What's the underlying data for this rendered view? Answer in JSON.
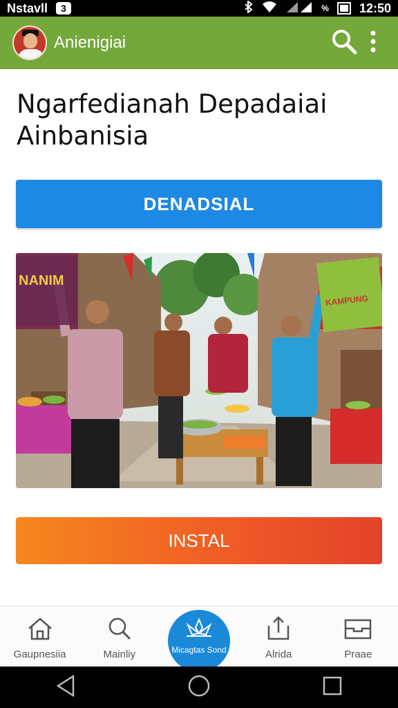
{
  "status_bar": {
    "carrier": "Nstavll",
    "badge": "3",
    "battery_percent_label": "%",
    "time": "12:50"
  },
  "app_bar": {
    "title": "Anienigiai",
    "icons": [
      "avatar",
      "search-icon",
      "more-vert-icon"
    ]
  },
  "headline": {
    "line1": "Ngarfedianah Depadaiai",
    "line2": "Ainbanisia"
  },
  "primary_button": {
    "label": "DENADSIAL",
    "color": "#1e88e5"
  },
  "photo": {
    "banner_left": "NANIM",
    "banner_right": "KAMPUNG"
  },
  "install_button": {
    "label": "INSTAL",
    "color_start": "#f6871e",
    "color_end": "#e2432a"
  },
  "bottom_nav": {
    "items": [
      {
        "label": "Gaupnesiia",
        "icon": "home-icon"
      },
      {
        "label": "Mainliy",
        "icon": "search-icon"
      },
      {
        "label": "Micagtas Sond",
        "icon": "lotus-icon"
      },
      {
        "label": "Alrida",
        "icon": "share-icon"
      },
      {
        "label": "Praae",
        "icon": "inbox-icon"
      }
    ],
    "center_color": "#1a89d8"
  },
  "colors": {
    "app_bar": "#74a83b"
  }
}
